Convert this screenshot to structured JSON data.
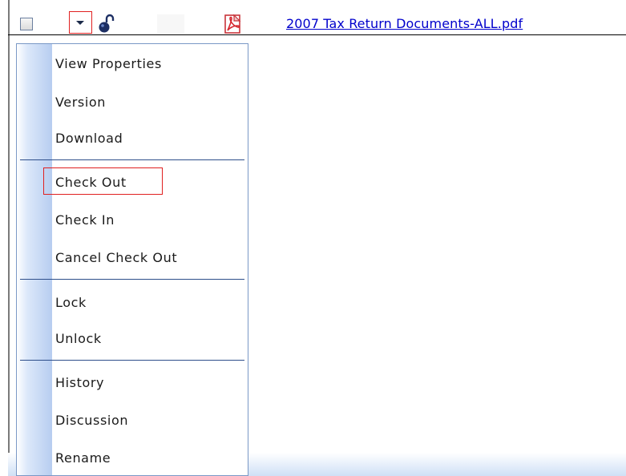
{
  "row": {
    "file_name": "2007 Tax Return Documents-ALL.pdf",
    "icons": {
      "checkbox": "checkbox-icon",
      "dropdown": "chevron-down-icon",
      "lock": "unlocked-padlock-icon",
      "file": "pdf-icon"
    }
  },
  "context_menu": {
    "items": [
      {
        "label": "View Properties"
      },
      {
        "label": "Version"
      },
      {
        "label": "Download"
      },
      {
        "label": "Check Out"
      },
      {
        "label": "Check In"
      },
      {
        "label": "Cancel Check Out"
      },
      {
        "label": "Lock"
      },
      {
        "label": "Unlock"
      },
      {
        "label": "History"
      },
      {
        "label": "Discussion"
      },
      {
        "label": "Rename"
      }
    ]
  },
  "colors": {
    "link": "#0000cc",
    "highlight_border": "#e02020",
    "menu_border": "#7a98c6",
    "menu_separator": "#2d4e8a",
    "menu_gutter": "#b7cdf0"
  }
}
